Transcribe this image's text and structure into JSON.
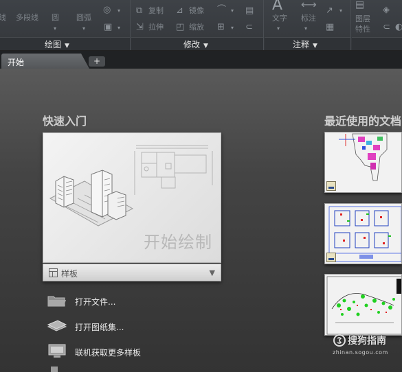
{
  "ribbon": {
    "tools": {
      "line": "线",
      "polyline": "多段线",
      "circle": "圆",
      "arc": "圆弧",
      "copy": "复制",
      "mirror": "镜像",
      "stretch": "拉伸",
      "scale": "缩放",
      "text": "文字",
      "dimension": "标注",
      "layer_props": "图层",
      "layer_props_2": "特性"
    },
    "panels": {
      "draw": "绘图",
      "modify": "修改",
      "annotation": "注释"
    }
  },
  "tabs": {
    "start": "开始",
    "add": "+"
  },
  "main": {
    "quick_start_title": "快速入门",
    "start_drawing_label": "开始绘制",
    "template_label": "样板",
    "links": {
      "open_files": "打开文件...",
      "open_sheet_set": "打开图纸集...",
      "online_templates": "联机获取更多样板"
    },
    "recent_title": "最近使用的文档"
  },
  "watermark": {
    "text": "搜狗指南",
    "url": "zhinan.sogou.com"
  },
  "colors": {
    "ribbon_bg": "#3b3f44",
    "tab_bar_bg": "#202224",
    "content_bg_top": "#5a5a5a",
    "content_bg_bottom": "#333333"
  }
}
